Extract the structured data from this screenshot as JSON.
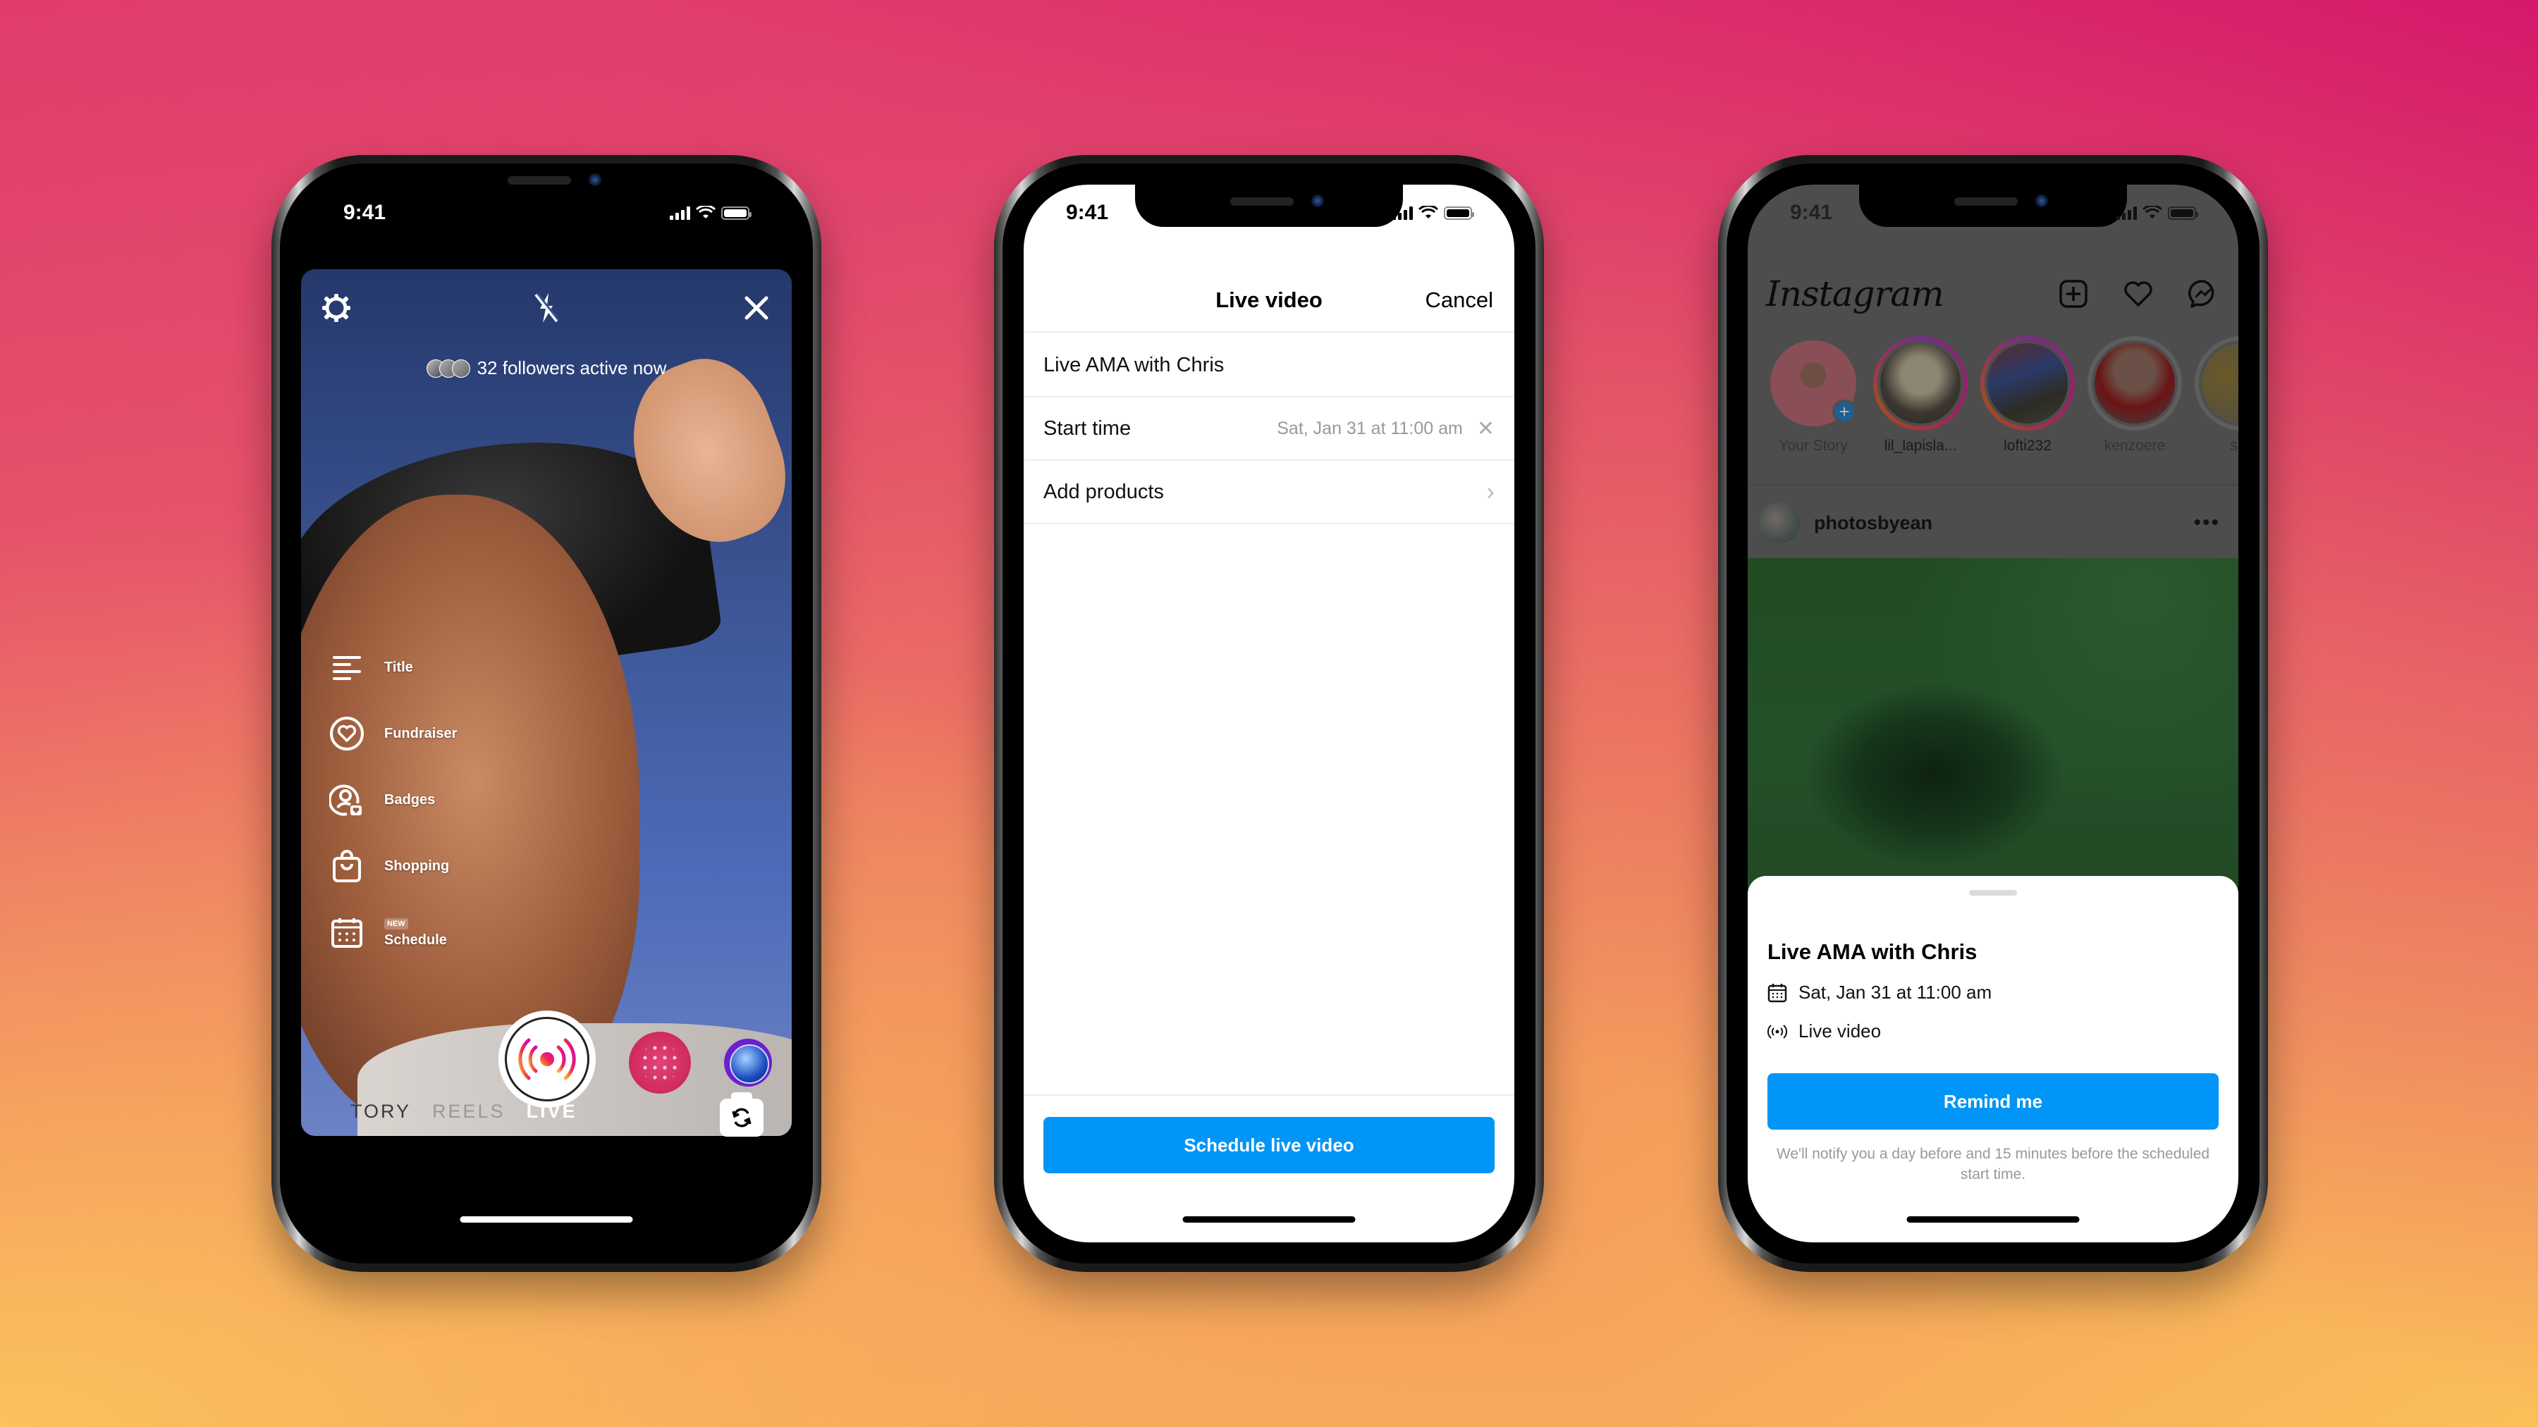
{
  "colors": {
    "background_top_right": "#d4126c",
    "background_bottom_left": "#fbbf59",
    "instagram_blue": "#0095f6",
    "live_gradient_start": "#f9b92b",
    "live_gradient_end": "#d300c5"
  },
  "phones": [
    {
      "id": "camera-live",
      "status_bar": {
        "time": "9:41"
      },
      "top_controls": {
        "settings_icon": "gear-icon",
        "flash_icon": "flash-off-icon",
        "close_icon": "close-icon"
      },
      "followers_active_text": "32 followers active now",
      "tools": [
        {
          "icon": "title-lines-icon",
          "label": "Title",
          "badge": ""
        },
        {
          "icon": "heart-circle-icon",
          "label": "Fundraiser",
          "badge": ""
        },
        {
          "icon": "badge-user-heart-icon",
          "label": "Badges",
          "badge": ""
        },
        {
          "icon": "shopping-bag-icon",
          "label": "Shopping",
          "badge": ""
        },
        {
          "icon": "calendar-icon",
          "label": "Schedule",
          "badge": "NEW"
        }
      ],
      "modes": [
        {
          "label": "TORY",
          "state": "faded"
        },
        {
          "label": "REELS",
          "state": "inactive"
        },
        {
          "label": "LIVE",
          "state": "active"
        }
      ],
      "shutter_icon": "live-broadcast-icon",
      "flip_camera_icon": "flip-camera-icon"
    },
    {
      "id": "schedule-form",
      "status_bar": {
        "time": "9:41"
      },
      "header": {
        "title": "Live video",
        "cancel_label": "Cancel"
      },
      "fields": {
        "title_value": "Live AMA with Chris",
        "start_time_label": "Start time",
        "start_time_value": "Sat, Jan 31 at 11:00 am",
        "add_products_label": "Add products"
      },
      "submit_label": "Schedule live video"
    },
    {
      "id": "feed-reminder",
      "status_bar": {
        "time": "9:41"
      },
      "app_logo": "Instagram",
      "header_icons": [
        "new-post-icon",
        "heart-icon",
        "messenger-icon"
      ],
      "stories": [
        {
          "name": "Your Story",
          "ring": "own"
        },
        {
          "name": "lil_lapisla...",
          "ring": "unseen"
        },
        {
          "name": "lofti232",
          "ring": "unseen"
        },
        {
          "name": "kenzoere",
          "ring": "seen"
        },
        {
          "name": "sap",
          "ring": "seen"
        }
      ],
      "post": {
        "username": "photosbyean",
        "more_label": "•••"
      },
      "sheet": {
        "title": "Live AMA with Chris",
        "date": "Sat, Jan 31 at 11:00 am",
        "type": "Live video",
        "button_label": "Remind me",
        "note": "We'll notify you a day before and 15 minutes before the scheduled start time."
      }
    }
  ]
}
